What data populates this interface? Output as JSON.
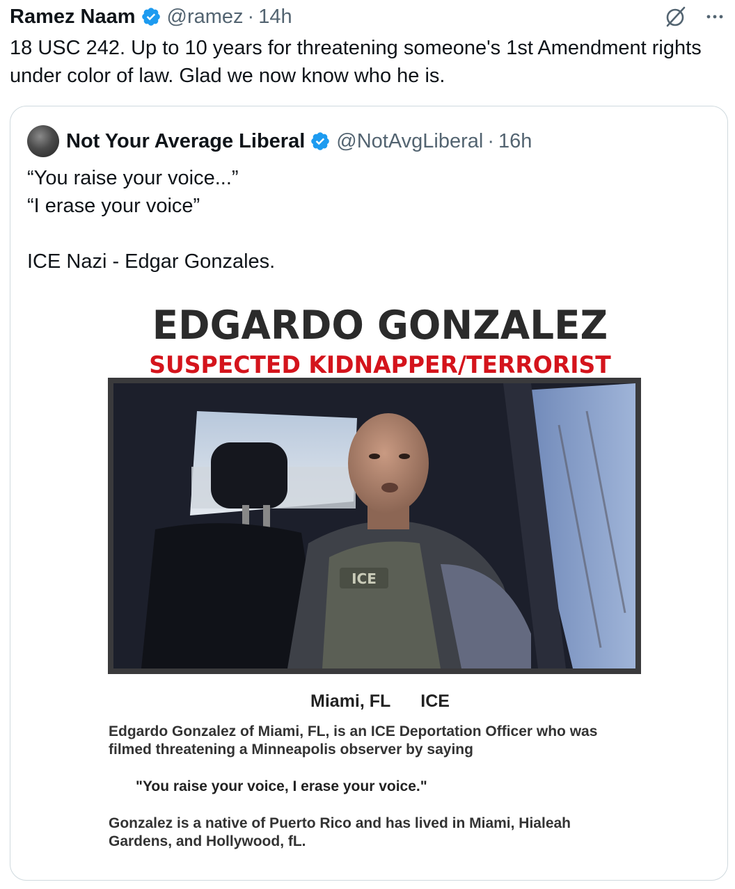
{
  "tweet": {
    "author_name": "Ramez Naam",
    "handle": "@ramez",
    "separator": "·",
    "time": "14h",
    "text": "18 USC 242. Up to 10 years for threatening someone's 1st Amendment rights under color of law. Glad we now know who he is.",
    "icons": [
      "verified-badge",
      "grok-icon",
      "more-options-icon"
    ]
  },
  "quoted_tweet": {
    "author_name": "Not Your Average Liberal",
    "handle": "@NotAvgLiberal",
    "separator": "·",
    "time": "16h",
    "lines": [
      "“You raise your voice...”",
      "“I erase your voice”",
      "",
      "ICE Nazi - Edgar Gonzales."
    ],
    "image": {
      "title": "EDGARDO GONZALEZ",
      "subtitle": "SUSPECTED KIDNAPPER/TERRORIST",
      "location": "Miami, FL",
      "agency": "ICE",
      "paragraph1": "Edgardo Gonzalez of Miami, FL, is an ICE Deportation Officer who was filmed threatening a Minneapolis observer by saying",
      "quote": "\"You raise your voice, I erase your voice.\"",
      "paragraph2": "Gonzalez is a native of Puerto Rico and has lived in Miami, Hialeah Gardens, and Hollywood, fL.",
      "vest_text": "ICE"
    }
  },
  "colors": {
    "text": "#0f1419",
    "secondary": "#536471",
    "verified_blue": "#1d9bf0",
    "border": "#cfd9de",
    "poster_red": "#d4141c"
  }
}
